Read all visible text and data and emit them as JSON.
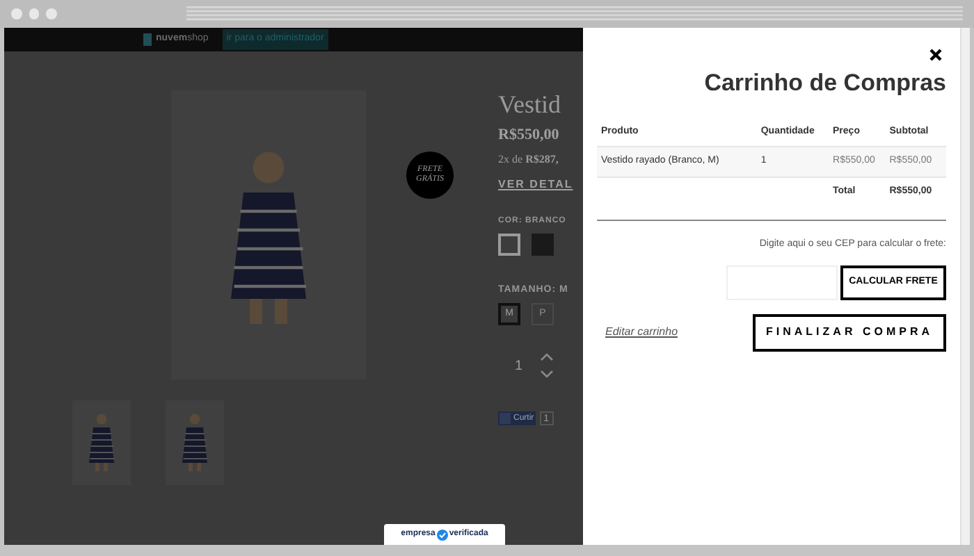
{
  "store": {
    "brand_bold": "nuvem",
    "brand_light": "shop",
    "admin_link": "ir para o administrador",
    "product_title": "Vestid",
    "price": "R$550,00",
    "installments": "2x de **R$287,**",
    "details_link": "VER DETAL",
    "badge": "FRETE GRÁTIS",
    "color_label": "COR: BRANCO",
    "colors": [
      {
        "color": "#3c3c3c",
        "selected": true
      },
      {
        "color": "#1a1a1a",
        "selected": false
      }
    ],
    "size_label": "TAMANHO: M",
    "sizes": [
      {
        "label": "M",
        "selected": true
      },
      {
        "label": "P",
        "selected": false
      }
    ],
    "quantity": "1",
    "like_button": "Curtir",
    "like_count": "1"
  },
  "cart": {
    "title": "Carrinho de Compras",
    "columns": [
      "Produto",
      "Quantidade",
      "Preço",
      "Subtotal"
    ],
    "rows": [
      [
        "Vestido rayado (Branco, M)",
        "1",
        "R$550,00",
        "R$550,00"
      ]
    ],
    "total_label": "Total",
    "total": "R$550,00",
    "cep_prompt": "Digite aqui o seu CEP para calcular o frete:",
    "calc_button": "CALCULAR FRETE",
    "edit_link": "Editar carrinho",
    "checkout_button": "FINALIZAR COMPRA"
  },
  "seal": {
    "left": "empresa",
    "right": "verificada"
  }
}
